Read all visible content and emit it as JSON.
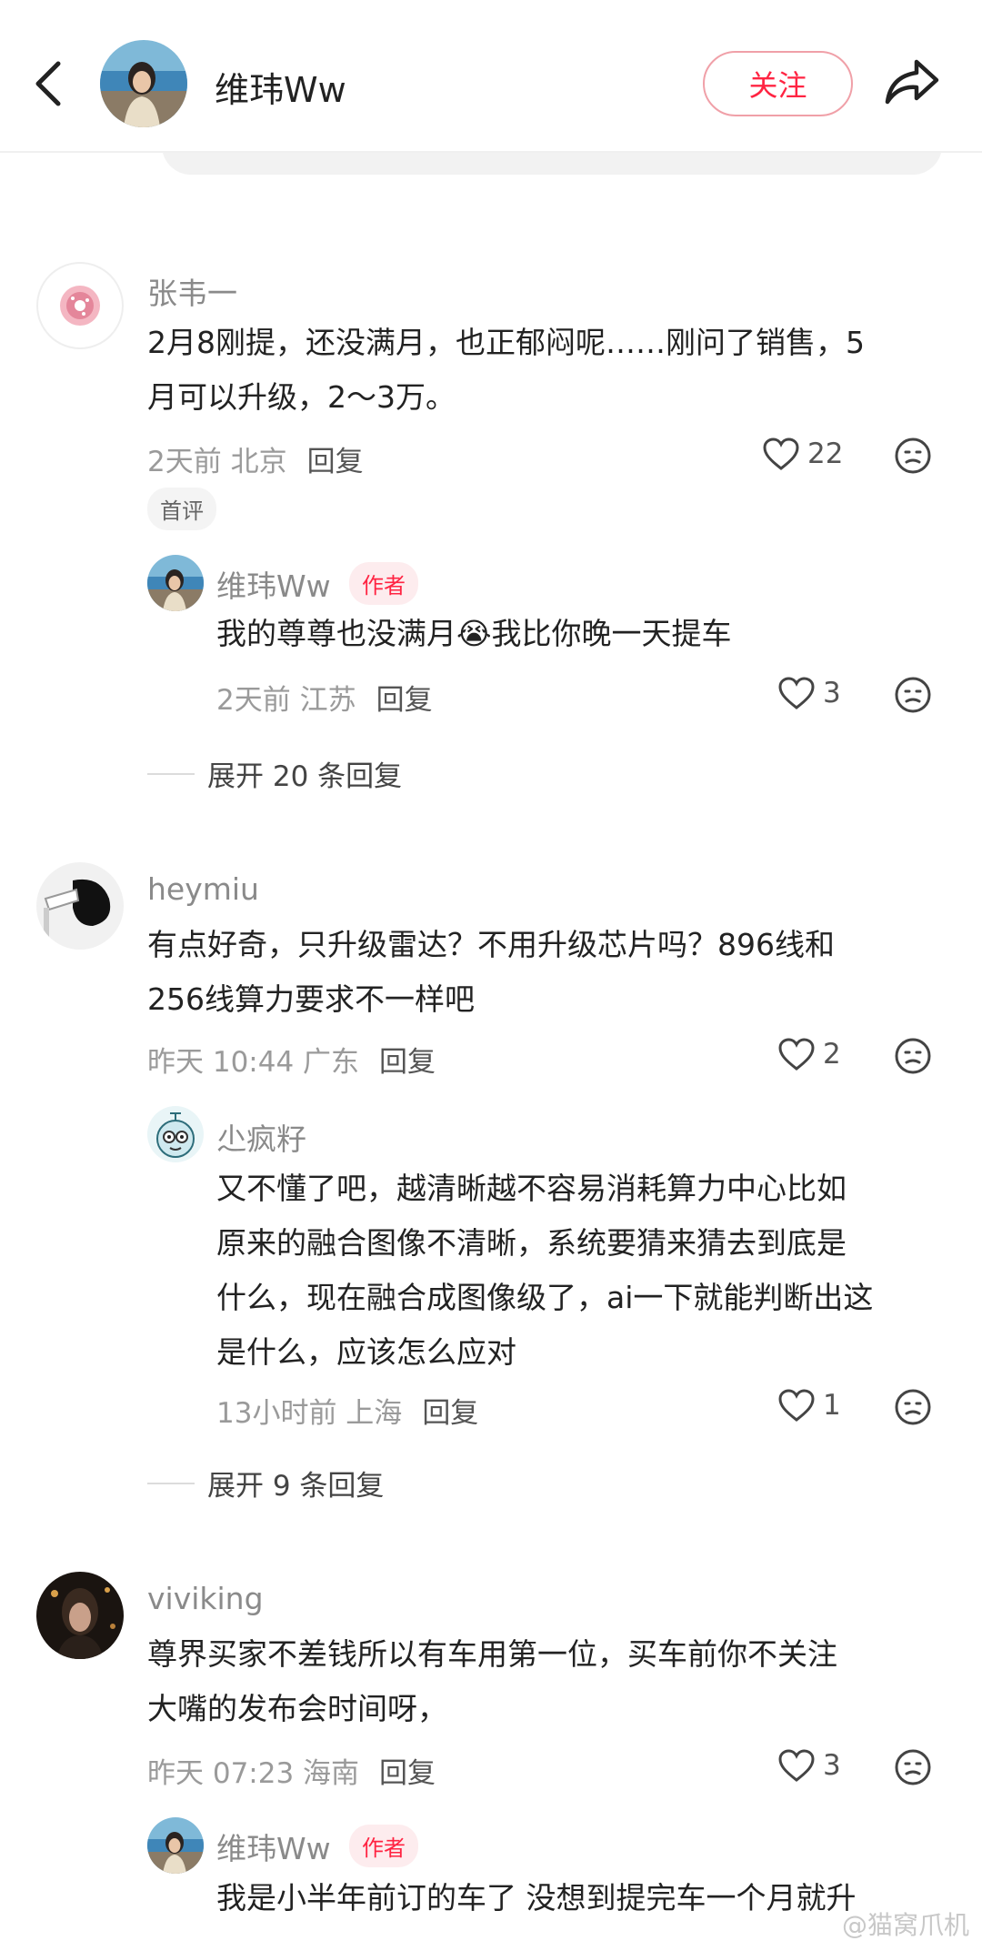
{
  "header": {
    "author_name": "维玮Ww",
    "follow_label": "关注",
    "icons": [
      "back-icon",
      "avatar",
      "share-icon"
    ]
  },
  "comments": [
    {
      "user": "张韦一",
      "lines": [
        "2月8刚提，还没满月，也正郁闷呢……刚问了销售，5",
        "月可以升级，2～3万。"
      ],
      "time_location": "2天前 北京",
      "reply_label": "回复",
      "likes": "22",
      "badge": "首评",
      "reply": {
        "user": "维玮Ww",
        "badge": "作者",
        "lines": [
          "我的尊尊也没满月😭我比你晚一天提车"
        ],
        "time_location": "2天前 江苏",
        "reply_label": "回复",
        "likes": "3"
      },
      "expand_label": "展开 20 条回复"
    },
    {
      "user": "heymiu",
      "lines": [
        "有点好奇，只升级雷达？不用升级芯片吗？896线和",
        "256线算力要求不一样吧"
      ],
      "time_location": "昨天 10:44 广东",
      "reply_label": "回复",
      "likes": "2",
      "reply": {
        "user": "尐疯籽",
        "lines": [
          "又不懂了吧，越清晰越不容易消耗算力中心比如",
          "原来的融合图像不清晰，系统要猜来猜去到底是",
          "什么，现在融合成图像级了，ai一下就能判断出这",
          "是什么，应该怎么应对"
        ],
        "time_location": "13小时前 上海",
        "reply_label": "回复",
        "likes": "1"
      },
      "expand_label": "展开 9 条回复"
    },
    {
      "user": "viviking",
      "lines": [
        "尊界买家不差钱所以有车用第一位，买车前你不关注",
        "大嘴的发布会时间呀，"
      ],
      "time_location": "昨天 07:23 海南",
      "reply_label": "回复",
      "likes": "3",
      "reply": {
        "user": "维玮Ww",
        "badge": "作者",
        "lines": [
          "我是小半年前订的车了 没想到提完车一个月就升"
        ]
      }
    }
  ],
  "watermark": "@猫窝爪机",
  "colors": {
    "accent": "#ff2442",
    "muted": "#9a9a9a"
  }
}
